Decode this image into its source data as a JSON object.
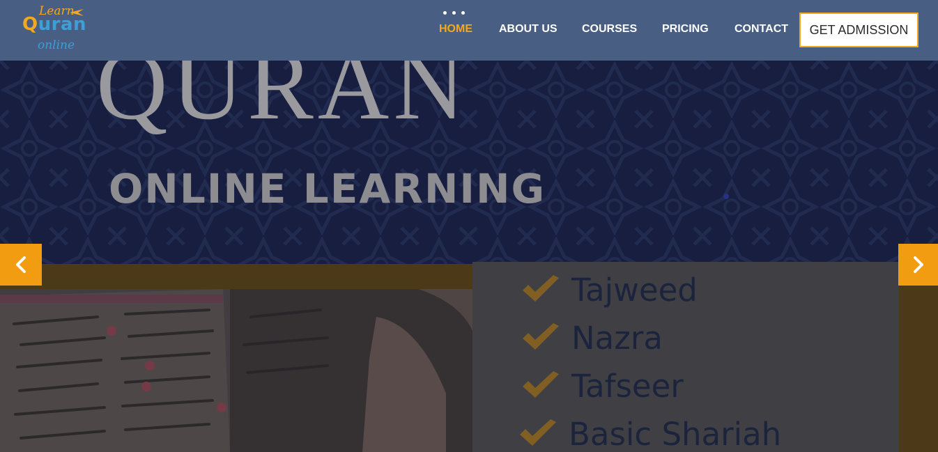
{
  "brand": {
    "logo_learn": "Learn",
    "logo_q": "Q",
    "logo_uran": "uran",
    "logo_online": "online",
    "colors": {
      "header_bg": "#485e82",
      "accent": "#f3a823",
      "logo_blue": "#3d9fd6",
      "arrow_bg": "#f29c11"
    }
  },
  "nav": {
    "items": [
      {
        "label": "HOME",
        "active": true
      },
      {
        "label": "ABOUT US",
        "active": false
      },
      {
        "label": "COURSES",
        "active": false
      },
      {
        "label": "PRICING",
        "active": false
      },
      {
        "label": "CONTACT",
        "active": false
      }
    ],
    "cta_label": "GET ADMISSION"
  },
  "hero": {
    "title": "QURAN",
    "subtitle": "ONLINE LEARNING",
    "courses": [
      "Tajweed",
      "Nazra",
      "Tafseer",
      "Basic Shariah"
    ],
    "prev_icon": "chevron-left-icon",
    "next_icon": "chevron-right-icon"
  }
}
